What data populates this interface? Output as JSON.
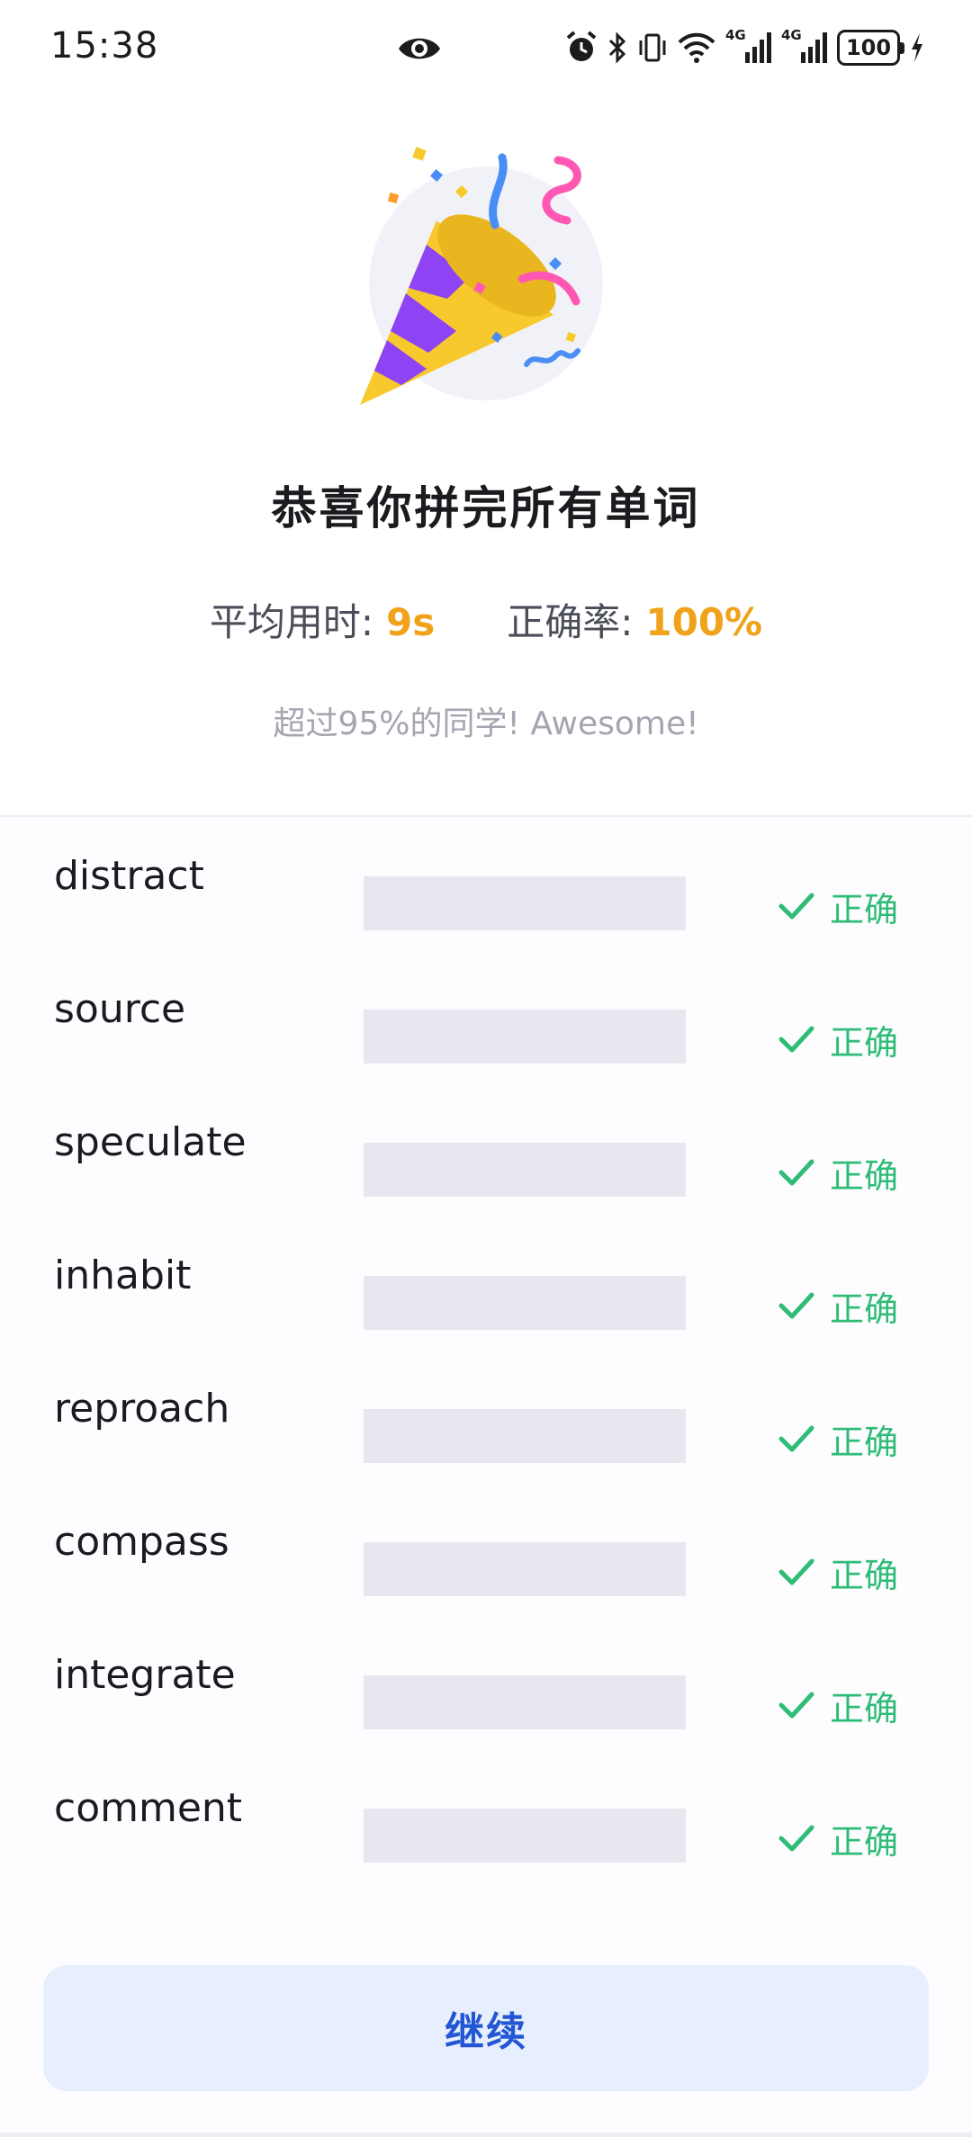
{
  "status_bar": {
    "time": "15:38",
    "net1": "4G",
    "net2": "4G",
    "battery": "100"
  },
  "result": {
    "title": "恭喜你拼完所有单词",
    "avg_time_label": "平均用时:",
    "avg_time_value": "9s",
    "accuracy_label": "正确率:",
    "accuracy_value": "100%",
    "subtitle": "超过95%的同学! Awesome!"
  },
  "words": [
    {
      "word": "distract",
      "status": "正确"
    },
    {
      "word": "source",
      "status": "正确"
    },
    {
      "word": "speculate",
      "status": "正确"
    },
    {
      "word": "inhabit",
      "status": "正确"
    },
    {
      "word": "reproach",
      "status": "正确"
    },
    {
      "word": "compass",
      "status": "正确"
    },
    {
      "word": "integrate",
      "status": "正确"
    },
    {
      "word": "comment",
      "status": "正确"
    }
  ],
  "continue_label": "继续",
  "colors": {
    "accent_orange": "#f0a21a",
    "correct_green": "#2fbc77",
    "button_blue": "#2457d4",
    "button_bg": "#e7efff"
  },
  "icons": [
    "eye-icon",
    "alarm-icon",
    "bluetooth-icon",
    "vibrate-icon",
    "wifi-icon",
    "signal-icon",
    "battery-icon",
    "charging-icon",
    "party-popper-icon",
    "check-icon"
  ]
}
